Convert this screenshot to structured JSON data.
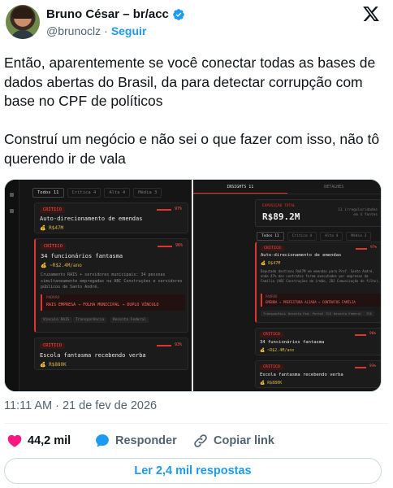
{
  "author": {
    "name": "Bruno César – br/acc",
    "handle": "@brunoclz",
    "follow_label": "Seguir"
  },
  "tweet": {
    "text": "Então, aparentemente se você conectar todas as bases de dados abertas do Brasil, da para detectar corrupção com base no CPF de políticos\n\nConstruí um negócio e não sei o que fazer com isso, não tô querendo ir de vala",
    "timestamp": "11:11 AM · 21 de fev de 2026"
  },
  "media_left": {
    "tabs": [
      "Todos 11",
      "Crítica 4",
      "Alta 4",
      "Média 3"
    ],
    "cards": [
      {
        "badge": "CRÍTICO",
        "score": "97%",
        "title": "Auto-direcionamento de emendas",
        "amount": "R$47M"
      },
      {
        "badge": "CRÍTICO",
        "score": "96%",
        "title": "34 funcionários fantasma",
        "amount": "~R$2.4M/ano",
        "body": "Cruzamento RAIS + servidores municipais: 34 pessoas simultaneamente empregadas na ABC Construções e servidores públicos de Santo André.",
        "pattern_header": "PADRÃO",
        "pattern": "RAIS EMPRESA → FOLHA MUNICIPAL → DUPLO VÍNCULO",
        "chips": [
          "Vínculo RAIS",
          "Transparência",
          "Receita Federal"
        ]
      },
      {
        "badge": "CRÍTICO",
        "score": "93%",
        "title": "Escola fantasma recebendo verba",
        "amount": "R$880K"
      }
    ]
  },
  "media_right": {
    "tabs": [
      "INSIGHTS 11",
      "DETALHES"
    ],
    "total_label": "EXPOSIÇÃO TOTAL",
    "total_value": "R$89.2M",
    "irregularities": "11 irregularidades",
    "irregularities_sub": "em 4 fontes",
    "filter_tabs": [
      "Todos 11",
      "Crítica 4",
      "Alta 4",
      "Média 3"
    ],
    "cards": [
      {
        "badge": "CRÍTICO",
        "score": "97%",
        "title": "Auto-direcionamento de emendas",
        "amount": "R$47M",
        "body": "Deputado destinou R$47M em emendas para Prof. Santo André, onde 47% dos contratos foram executados por empresas da Família (ABC Construções de irmão, JDJ Comunicação do filho).",
        "pattern_header": "PADRÃO",
        "pattern": "EMENDA → PREFEITURA ALIADA → CONTRATOS FAMÍLIA",
        "chips": [
          "Transparência",
          "Receita Fed.",
          "Portal TCE",
          "Receita Federal",
          "TSE"
        ]
      },
      {
        "badge": "CRÍTICO",
        "score": "96%",
        "title": "34 funcionários fantasma",
        "amount": "~R$2.4M/ano"
      },
      {
        "badge": "CRÍTICO",
        "score": "93%",
        "title": "Escola fantasma recebendo verba",
        "amount": "R$880K"
      }
    ]
  },
  "stats": {
    "likes": "44,2 mil",
    "reply_label": "Responder",
    "copy_label": "Copiar link",
    "read_replies": "Ler 2,4 mil respostas"
  },
  "colors": {
    "accent": "#1d9bf0",
    "like": "#f91880",
    "alert": "#e0342f"
  }
}
